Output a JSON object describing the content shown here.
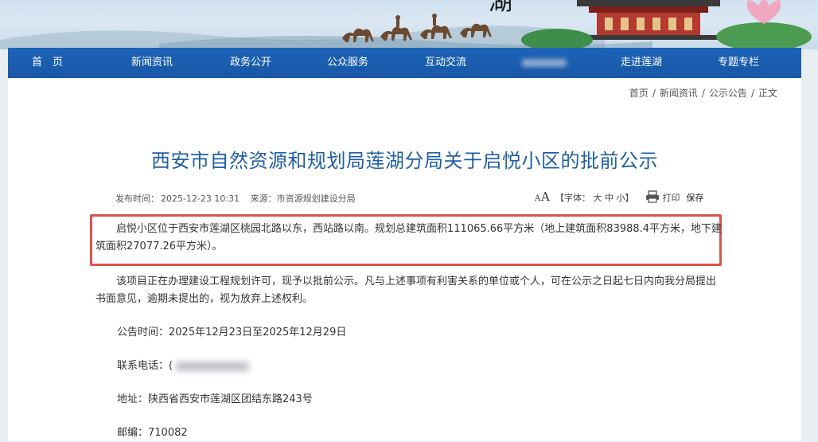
{
  "header": {
    "banner_title_fragment": "湖"
  },
  "nav": {
    "items": [
      {
        "label": "首　页",
        "blurred": false
      },
      {
        "label": "新闻资讯",
        "blurred": false
      },
      {
        "label": "政务公开",
        "blurred": false
      },
      {
        "label": "公众服务",
        "blurred": false
      },
      {
        "label": "互动交流",
        "blurred": false
      },
      {
        "label": "",
        "blurred": true
      },
      {
        "label": "走进莲湖",
        "blurred": false
      },
      {
        "label": "专题专栏",
        "blurred": false
      }
    ]
  },
  "breadcrumb": {
    "home": "首页",
    "sep": "/",
    "news": "新闻资讯",
    "notices": "公示公告",
    "current": "正文"
  },
  "article": {
    "title": "西安市自然资源和规划局莲湖分局关于启悦小区的批前公示",
    "publish_label": "发布时间：",
    "publish_time": "2025-12-23 10:31",
    "source_label": "来源：",
    "source": "市资源规划建设分局",
    "font_label": "【字体：",
    "font_large": "大",
    "font_medium": "中",
    "font_small": "小",
    "font_close": "】",
    "print_label": "打印",
    "save_label": "保存",
    "para1": "启悦小区位于西安市莲湖区桃园北路以东，西站路以南。规划总建筑面积111065.66平方米（地上建筑面积83988.4平方米，地下建筑面积27077.26平方米）。",
    "para2": "该项目正在办理建设工程规划许可，现予以批前公示。凡与上述事项有利害关系的单位或个人，可在公示之日起七日内向我分局提出书面意见，逾期未提出的，视为放弃上述权利。",
    "notice_time": "公告时间：2025年12月23日至2025年12月29日",
    "phone_label": "联系电话：",
    "phone_value": "(",
    "address": "地址：陕西省西安市莲湖区团结东路243号",
    "postcode": "邮编：710082"
  },
  "colors": {
    "nav_bg": "#1d63b8",
    "title": "#1f5fa6",
    "highlight_border": "#d9534f"
  },
  "icons": [
    "font-size-icon",
    "printer-icon"
  ]
}
